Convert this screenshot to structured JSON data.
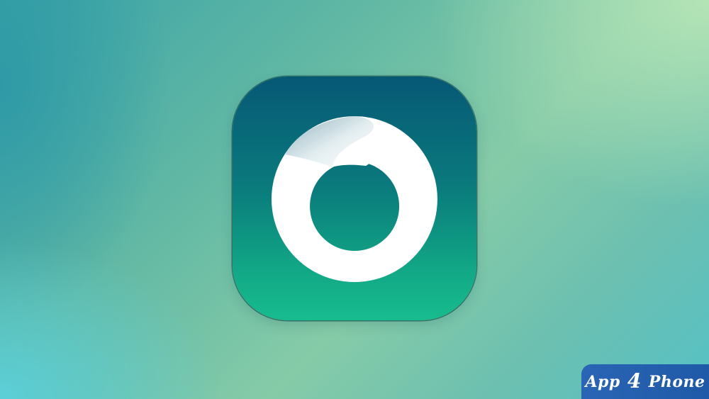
{
  "app_icon": {
    "icon_name": "circular-swirl-logo-icon",
    "colors": {
      "gradient_top": "#065875",
      "gradient_bottom": "#17bc8e",
      "mark": "#ffffff"
    }
  },
  "watermark": {
    "part1": "App",
    "part2": "4",
    "part3": "Phone",
    "background": "#2a64b4"
  }
}
